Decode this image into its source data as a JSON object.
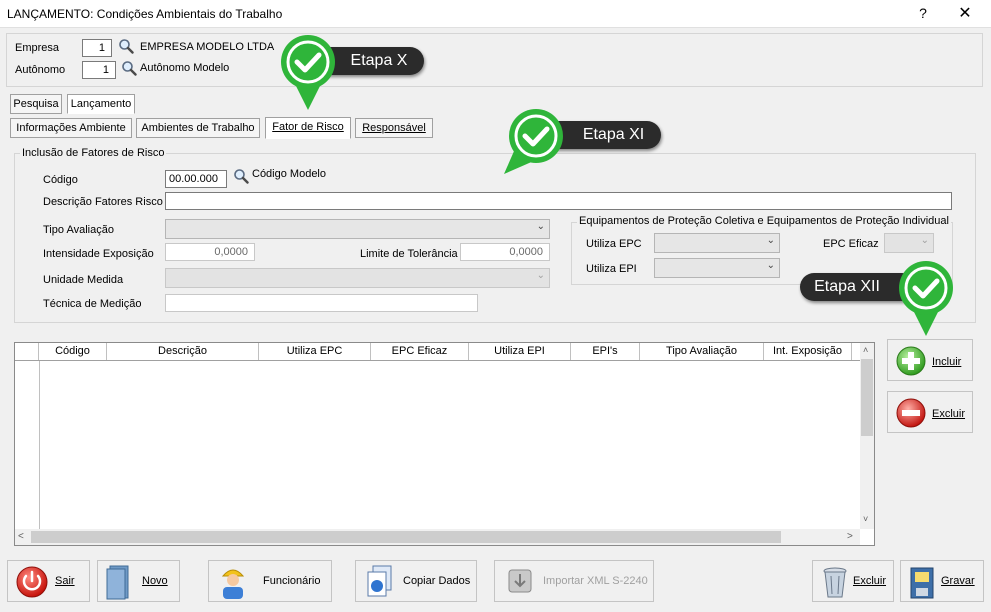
{
  "window": {
    "title": "LANÇAMENTO: Condições Ambientais do Trabalho",
    "help_label": "?",
    "close_label": "✕"
  },
  "header": {
    "empresa_label": "Empresa",
    "empresa_value": "1",
    "empresa_name": "EMPRESA MODELO LTDA",
    "autonomo_label": "Autônomo",
    "autonomo_value": "1",
    "autonomo_name": "Autônomo Modelo"
  },
  "tabs_top": [
    "Pesquisa",
    "Lançamento"
  ],
  "tabs_sub": [
    "Informações Ambiente",
    "Ambientes de Trabalho",
    "Fator de Risco",
    "Responsável"
  ],
  "inclusao": {
    "legend": "Inclusão de Fatores de Risco",
    "codigo_label": "Código",
    "codigo_value": "00.00.000",
    "codigo_name": "Código Modelo",
    "descricao_label": "Descrição Fatores Risco",
    "tipo_label": "Tipo Avaliação",
    "intensidade_label": "Intensidade Exposição",
    "intensidade_value": "0,0000",
    "limite_label": "Limite de Tolerância",
    "limite_value": "0,0000",
    "unidade_label": "Unidade Medida",
    "tecnica_label": "Técnica de Medição"
  },
  "epc": {
    "legend": "Equipamentos de Proteção Coletiva e Equipamentos de Proteção Individual",
    "utiliza_epc_label": "Utiliza EPC",
    "epc_eficaz_label": "EPC Eficaz",
    "utiliza_epi_label": "Utiliza EPI"
  },
  "grid": {
    "columns": [
      "Código",
      "Descrição",
      "Utiliza EPC",
      "EPC Eficaz",
      "Utiliza EPI",
      "EPI's",
      "Tipo Avaliação",
      "Int. Exposição"
    ]
  },
  "side_buttons": {
    "incluir": "Incluir",
    "excluir": "Excluir"
  },
  "bottom_buttons": {
    "sair": "Sair",
    "novo": "Novo",
    "funcionario": "Funcionário",
    "copiar": "Copiar Dados",
    "importar": "Importar XML S-2240",
    "excluir": "Excluir",
    "gravar": "Gravar"
  },
  "callouts": {
    "x": "Etapa X",
    "xi": "Etapa XI",
    "xii": "Etapa XII"
  },
  "colors": {
    "callout_green": "#2fb53a",
    "callout_dark": "#2b2b2b"
  }
}
